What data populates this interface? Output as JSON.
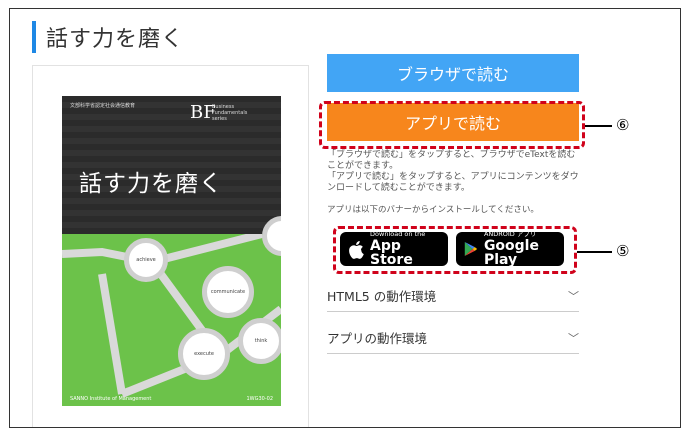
{
  "page": {
    "title": "話す力を磨く"
  },
  "book": {
    "publisher_small": "文部科学省認定社会通信教育",
    "logo": "BF",
    "series_label": "Business\nFundamentals\nseries",
    "cover_title": "話す力を磨く",
    "bubbles": [
      "achieve",
      "communicate",
      "think",
      "execute"
    ],
    "footer_left": "SANNO Institute of Management",
    "footer_right": "1WG30-02"
  },
  "actions": {
    "browser_label": "ブラウザで読む",
    "app_label": "アプリで読む"
  },
  "description": "「ブラウザで読む」をタップすると、ブラウザでeTextを読むことができます。\n「アプリで読む」をタップすると、アプリにコンテンツをダウンロードして読むことができます。",
  "install_note": "アプリは以下のバナーからインストールしてください。",
  "stores": {
    "appstore_small": "Download on the",
    "appstore_big": "App Store",
    "google_small": "ANDROID アプリ",
    "google_big": "Google Play"
  },
  "accordion": [
    {
      "label": "HTML5 の動作環境"
    },
    {
      "label": "アプリの動作環境"
    }
  ],
  "annotations": {
    "app_button_num": "⑥",
    "stores_num": "⑤"
  },
  "colors": {
    "accent": "#1e88e5",
    "browser_button": "#42a5f5",
    "app_button": "#f7861c",
    "highlight": "#d0021b",
    "book_green": "#6cc24a"
  }
}
